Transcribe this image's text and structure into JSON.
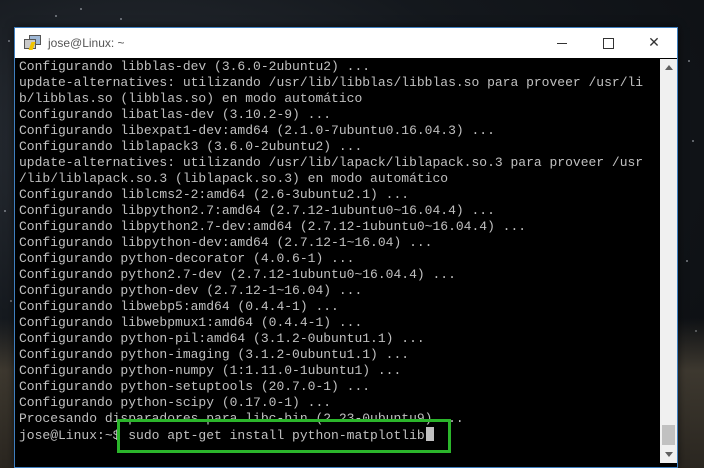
{
  "window": {
    "title": "jose@Linux: ~",
    "icon": "putty-icon",
    "controls": {
      "minimize": "minimize-icon",
      "maximize": "maximize-icon",
      "close": "close-icon"
    }
  },
  "terminal": {
    "lines": [
      "Configurando libblas-dev (3.6.0-2ubuntu2) ...",
      "update-alternatives: utilizando /usr/lib/libblas/libblas.so para proveer /usr/li",
      "b/libblas.so (libblas.so) en modo automático",
      "Configurando libatlas-dev (3.10.2-9) ...",
      "Configurando libexpat1-dev:amd64 (2.1.0-7ubuntu0.16.04.3) ...",
      "Configurando liblapack3 (3.6.0-2ubuntu2) ...",
      "update-alternatives: utilizando /usr/lib/lapack/liblapack.so.3 para proveer /usr",
      "/lib/liblapack.so.3 (liblapack.so.3) en modo automático",
      "Configurando liblcms2-2:amd64 (2.6-3ubuntu2.1) ...",
      "Configurando libpython2.7:amd64 (2.7.12-1ubuntu0~16.04.4) ...",
      "Configurando libpython2.7-dev:amd64 (2.7.12-1ubuntu0~16.04.4) ...",
      "Configurando libpython-dev:amd64 (2.7.12-1~16.04) ...",
      "Configurando python-decorator (4.0.6-1) ...",
      "Configurando python2.7-dev (2.7.12-1ubuntu0~16.04.4) ...",
      "Configurando python-dev (2.7.12-1~16.04) ...",
      "Configurando libwebp5:amd64 (0.4.4-1) ...",
      "Configurando libwebpmux1:amd64 (0.4.4-1) ...",
      "Configurando python-pil:amd64 (3.1.2-0ubuntu1.1) ...",
      "Configurando python-imaging (3.1.2-0ubuntu1.1) ...",
      "Configurando python-numpy (1:1.11.0-1ubuntu1) ...",
      "Configurando python-setuptools (20.7.0-1) ...",
      "Configurando python-scipy (0.17.0-1) ...",
      "Procesando disparadores para libc-bin (2.23-0ubuntu9) ..."
    ],
    "prompt": "jose@Linux:~$ ",
    "command": "sudo apt-get install python-matplotlib"
  },
  "colors": {
    "highlight": "#2bb52b",
    "text": "#c0c0c0",
    "background": "#000000"
  }
}
